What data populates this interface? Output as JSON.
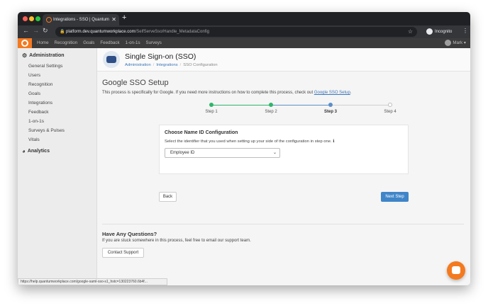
{
  "browser": {
    "tab_title": "Integrations - SSO | Quantum",
    "tab_close": "✕",
    "new_tab": "+",
    "url_host": "platform.dev.quantumworkplace.com",
    "url_path": "/SelfServeSso/Handle_MetadataConfig",
    "incognito_label": "Incognito",
    "status_url": "https://help.quantumworkplace.com/google-saml-sso-s1_hstc=130223760.6b4f..."
  },
  "appnav": {
    "links": [
      "Home",
      "Recognition",
      "Goals",
      "Feedback",
      "1-on-1s",
      "Surveys"
    ],
    "user_name": "Mark"
  },
  "sidebar": {
    "admin_heading": "Administration",
    "items": [
      "General Settings",
      "Users",
      "Recognition",
      "Goals",
      "Integrations",
      "Feedback",
      "1-on-1s",
      "Surveys & Pulses",
      "Vitals"
    ],
    "analytics_heading": "Analytics"
  },
  "header": {
    "title": "Single Sign-on (SSO)",
    "breadcrumbs": [
      "Administration",
      "Integrations",
      "SSO Configuration"
    ]
  },
  "setup": {
    "title": "Google SSO Setup",
    "description": "This process is specifically for Google. If you need more instructions on how to complete this process, check out",
    "link": "Google SSO Setup",
    "period": "."
  },
  "steps": [
    {
      "label": "Step 1",
      "state": "done"
    },
    {
      "label": "Step 2",
      "state": "done"
    },
    {
      "label": "Step 3",
      "state": "current"
    },
    {
      "label": "Step 4",
      "state": "todo"
    }
  ],
  "config": {
    "title": "Choose Name ID Configuration",
    "description": "Select the identifier that you used when setting up your side of the configuration in step one.",
    "info_icon": "ℹ",
    "selected": "Employee ID"
  },
  "buttons": {
    "back": "Back",
    "next": "Next Step",
    "contact": "Contact Support"
  },
  "questions": {
    "title": "Have Any Questions?",
    "description": "If you are stuck somewhere in this process, feel free to email our support team."
  },
  "colors": {
    "accent": "#f47a20",
    "primary_button": "#3f85c9",
    "step_done": "#2db66a",
    "step_current": "#5b8fc7"
  }
}
